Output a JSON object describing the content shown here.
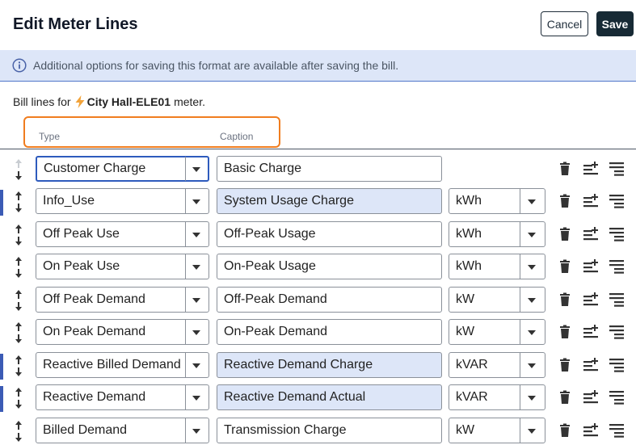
{
  "dialog": {
    "title": "Edit Meter Lines",
    "cancel_label": "Cancel",
    "save_label": "Save"
  },
  "banner": {
    "icon": "info-icon",
    "text": "Additional options for saving this format are available after saving the bill."
  },
  "bill_lines": {
    "prefix": "Bill lines for",
    "meter_icon": "lightning-bolt-icon",
    "meter_name": "City Hall-ELE01",
    "suffix": "meter."
  },
  "columns": {
    "type": "Type",
    "caption": "Caption"
  },
  "colors": {
    "accent_orange": "#f07d1f",
    "highlight_blue": "#dde6f8",
    "save_button": "#172a35",
    "left_marker": "#3b5bb5"
  },
  "rows": [
    {
      "type": "Customer Charge",
      "caption": "Basic Charge",
      "unit": ""
    },
    {
      "type": "Info_Use",
      "caption": "System Usage Charge",
      "unit": "kWh"
    },
    {
      "type": "Off Peak Use",
      "caption": "Off-Peak Usage",
      "unit": "kWh"
    },
    {
      "type": "On Peak Use",
      "caption": "On-Peak Usage",
      "unit": "kWh"
    },
    {
      "type": "Off Peak Demand",
      "caption": "Off-Peak Demand",
      "unit": "kW"
    },
    {
      "type": "On Peak Demand",
      "caption": "On-Peak Demand",
      "unit": "kW"
    },
    {
      "type": "Reactive Billed Demand",
      "caption": "Reactive Demand Charge",
      "unit": "kVAR"
    },
    {
      "type": "Reactive Demand",
      "caption": "Reactive Demand Actual",
      "unit": "kVAR"
    },
    {
      "type": "Billed Demand",
      "caption": "Transmission Charge",
      "unit": "kW"
    }
  ]
}
